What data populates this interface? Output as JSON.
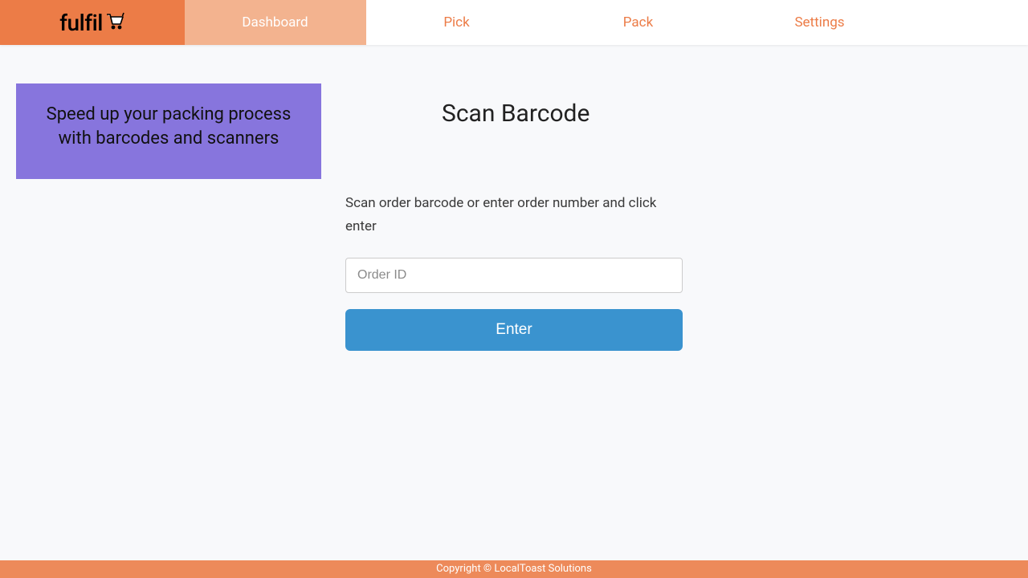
{
  "brand": {
    "name": "fulfil"
  },
  "nav": {
    "items": [
      {
        "label": "Dashboard",
        "active": true
      },
      {
        "label": "Pick",
        "active": false
      },
      {
        "label": "Pack",
        "active": false
      },
      {
        "label": "Settings",
        "active": false
      }
    ]
  },
  "promo": {
    "text": "Speed up your packing process with barcodes and scanners"
  },
  "scan": {
    "title": "Scan Barcode",
    "instruction": "Scan order barcode or enter order number and click enter",
    "placeholder": "Order ID",
    "button_label": "Enter"
  },
  "footer": {
    "text": "Copyright © LocalToast Solutions"
  },
  "colors": {
    "brand_orange": "#ec7c47",
    "nav_active_bg": "#f3b38f",
    "promo_bg": "#8775dd",
    "primary_button": "#3a93cf",
    "footer_bg": "#ed8a5a"
  }
}
